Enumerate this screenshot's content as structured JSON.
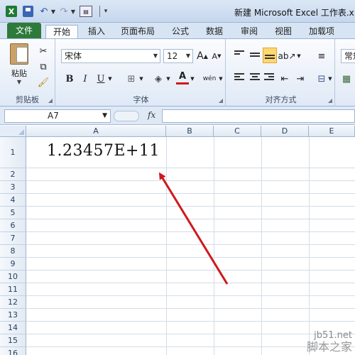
{
  "window": {
    "title": "新建 Microsoft Excel 工作表.x"
  },
  "tabs": [
    "文件",
    "开始",
    "插入",
    "页面布局",
    "公式",
    "数据",
    "审阅",
    "视图",
    "加载项"
  ],
  "ribbon": {
    "clipboard": {
      "paste_label": "粘贴",
      "group_label": "剪贴板"
    },
    "font": {
      "font_name": "宋体",
      "font_size": "12",
      "group_label": "字体",
      "bold": "B",
      "italic": "I",
      "underline": "U",
      "wen": "wén"
    },
    "alignment": {
      "group_label": "对齐方式"
    },
    "number": {
      "format_label": "常规"
    }
  },
  "formula_bar": {
    "name_box": "A7",
    "fx_label": "fx",
    "formula": ""
  },
  "grid": {
    "columns": [
      "A",
      "B",
      "C",
      "D",
      "E"
    ],
    "rows": [
      "1",
      "2",
      "3",
      "4",
      "5",
      "6",
      "7",
      "8",
      "9",
      "10",
      "11",
      "12",
      "13",
      "14",
      "15",
      "16"
    ],
    "cells": {
      "A1": "1.23457E+11"
    }
  },
  "annotation": {
    "arrow_color": "#d0191c"
  },
  "watermark": {
    "url": "jb51.net",
    "name": "脚本之家"
  }
}
